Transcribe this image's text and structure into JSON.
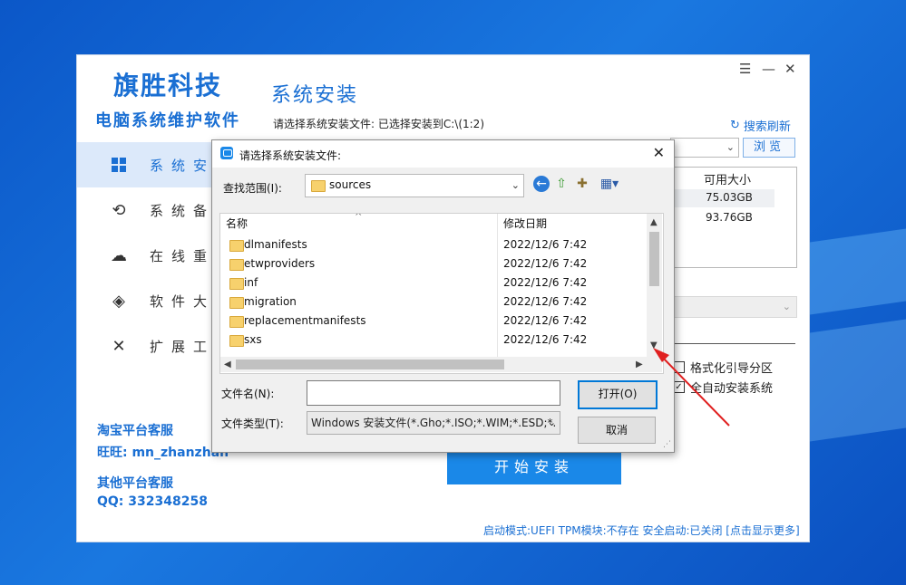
{
  "app": {
    "brand_name": "旗胜科技",
    "brand_subtitle": "电脑系统维护软件",
    "section_title": "系统安装",
    "install_hint": "请选择系统安装文件: 已选择安装到C:\\(1:2)",
    "refresh_label": "搜索刷新",
    "browse_label": "浏览",
    "nav": [
      {
        "label": "系统安",
        "icon": "windows-icon"
      },
      {
        "label": "系统备",
        "icon": "backup-icon"
      },
      {
        "label": "在线重",
        "icon": "cloud-icon"
      },
      {
        "label": "软件大",
        "icon": "dropbox-icon"
      },
      {
        "label": "扩展工",
        "icon": "tools-icon"
      }
    ],
    "support": {
      "taobao_title": "淘宝平台客服",
      "wangwang": "旺旺: mn_zhanzhan",
      "other_title": "其他平台客服",
      "qq": "QQ: 332348258"
    },
    "disk_table": {
      "header": "可用大小",
      "rows": [
        "75.03GB",
        "93.76GB"
      ]
    },
    "options": {
      "format_boot": "格式化引导分区",
      "auto_install": "全自动安装系统"
    },
    "start_button": "开始安装",
    "status_bar": "启动模式:UEFI TPM模块:不存在 安全启动:已关闭 [点击显示更多]"
  },
  "dialog": {
    "title": "请选择系统安装文件:",
    "lookin_label": "查找范围(I):",
    "lookin_value": "sources",
    "columns": {
      "name": "名称",
      "date": "修改日期"
    },
    "files": [
      {
        "name": "dlmanifests",
        "date": "2022/12/6 7:42"
      },
      {
        "name": "etwproviders",
        "date": "2022/12/6 7:42"
      },
      {
        "name": "inf",
        "date": "2022/12/6 7:42"
      },
      {
        "name": "migration",
        "date": "2022/12/6 7:42"
      },
      {
        "name": "replacementmanifests",
        "date": "2022/12/6 7:42"
      },
      {
        "name": "sxs",
        "date": "2022/12/6 7:42"
      }
    ],
    "filename_label": "文件名(N):",
    "filename_value": "",
    "filetype_label": "文件类型(T):",
    "filetype_value": "Windows 安装文件(*.Gho;*.ISO;*.WIM;*.ESD;*.",
    "open_button": "打开(O)",
    "cancel_button": "取消"
  },
  "colors": {
    "accent": "#1a6fd3",
    "start_button": "#1a88e8",
    "annotation": "#e02020"
  }
}
